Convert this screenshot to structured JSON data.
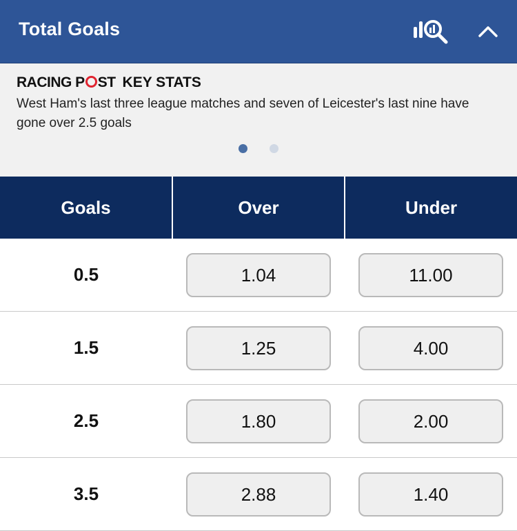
{
  "header": {
    "title": "Total Goals",
    "stats_icon": "stats-search-icon",
    "collapse_icon": "chevron-up-icon"
  },
  "key_stats": {
    "brand": "RACING POST",
    "label": "KEY STATS",
    "text": "West Ham's last three league matches and seven of Leicester's last nine have gone over 2.5 goals",
    "pagination": {
      "total": 2,
      "active": 1
    }
  },
  "table": {
    "columns": [
      "Goals",
      "Over",
      "Under"
    ],
    "rows": [
      {
        "goals": "0.5",
        "over": "1.04",
        "under": "11.00"
      },
      {
        "goals": "1.5",
        "over": "1.25",
        "under": "4.00"
      },
      {
        "goals": "2.5",
        "over": "1.80",
        "under": "2.00"
      },
      {
        "goals": "3.5",
        "over": "2.88",
        "under": "1.40"
      }
    ]
  },
  "colors": {
    "header_bg": "#2e5597",
    "table_header_bg": "#0d2b5e",
    "brand_accent": "#e0232f",
    "dot_active": "#4a6fa5",
    "dot_inactive": "#d0d8e4"
  }
}
